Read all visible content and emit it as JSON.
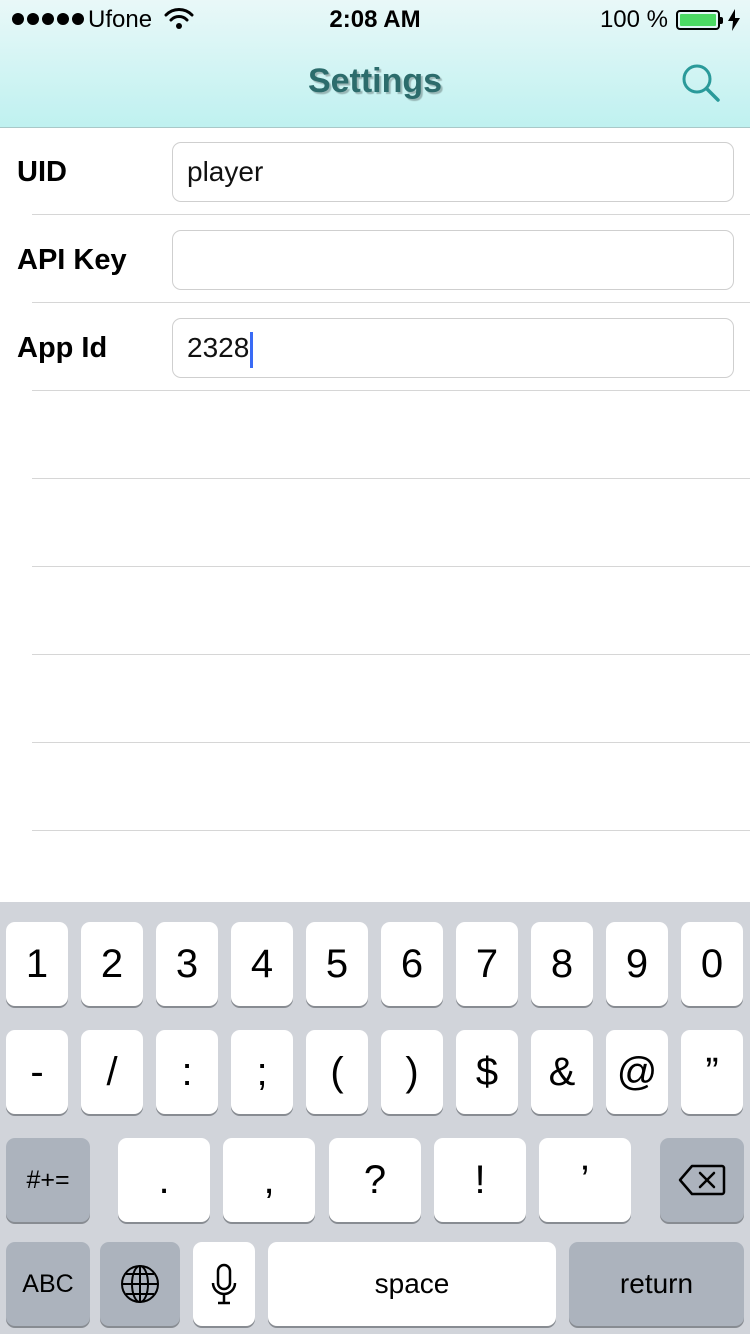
{
  "status_bar": {
    "carrier": "Ufone",
    "time": "2:08 AM",
    "battery_percent": "100 %",
    "battery_level": 1.0,
    "battery_color": "#4cd964"
  },
  "nav": {
    "title": "Settings",
    "search_icon": "search-icon"
  },
  "form": {
    "rows": [
      {
        "label": "UID",
        "value": "player",
        "placeholder": ""
      },
      {
        "label": "API Key",
        "value": "",
        "placeholder": ""
      },
      {
        "label": "App Id",
        "value": "2328",
        "placeholder": ""
      }
    ]
  },
  "keyboard": {
    "row1": [
      "1",
      "2",
      "3",
      "4",
      "5",
      "6",
      "7",
      "8",
      "9",
      "0"
    ],
    "row2": [
      "-",
      "/",
      ":",
      ";",
      "(",
      ")",
      "$",
      "&",
      "@",
      "”"
    ],
    "row3": {
      "mode_key": "#+=",
      "keys": [
        ".",
        ",",
        "?",
        "!",
        "’"
      ],
      "delete_icon": "delete-icon"
    },
    "row4": {
      "abc_key": "ABC",
      "globe_icon": "globe-icon",
      "mic_icon": "microphone-icon",
      "space_key": "space",
      "return_key": "return"
    }
  }
}
